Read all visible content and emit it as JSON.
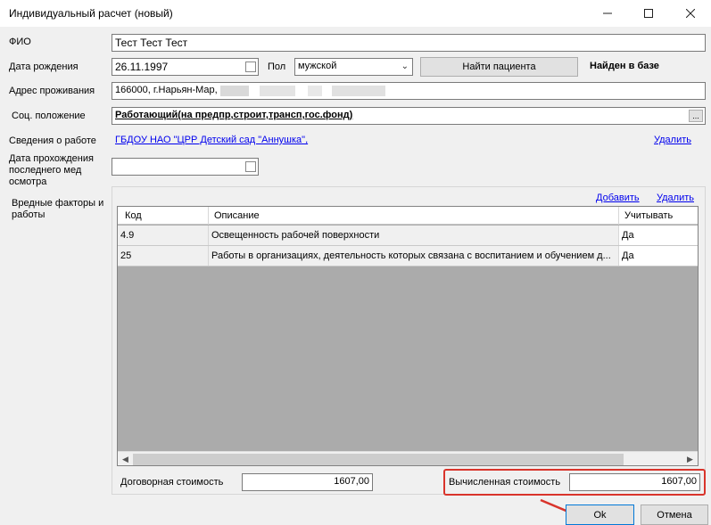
{
  "window": {
    "title": "Индивидуальный расчет (новый)"
  },
  "form": {
    "fio_label": "ФИО",
    "fio_value": "Тест Тест Тест",
    "dob_label": "Дата рождения",
    "dob_value": "26.11.1997",
    "sex_label": "Пол",
    "sex_value": "мужской",
    "find_button": "Найти пациента",
    "found_status": "Найден в базе",
    "address_label": "Адрес проживания",
    "address_value": "166000, г.Нарьян-Мар,",
    "social_label": "Соц. положение",
    "social_value": "Работающий(на предпр,строит,трансп,гос.фонд)",
    "ellipsis_button": "...",
    "work_label": "Сведения о работе",
    "work_value": "ГБДОУ НАО \"ЦРР  Детский сад \"Аннушка\",",
    "work_delete": "Удалить",
    "medexam_label": "Дата прохождения последнего мед осмотра",
    "medexam_value": "",
    "hazards_label": "Вредные факторы и работы",
    "hazards_add": "Добавить",
    "hazards_delete": "Удалить"
  },
  "table": {
    "columns": [
      "Код",
      "Описание",
      "Учитывать"
    ],
    "rows": [
      {
        "code": "4.9",
        "description": "Освещенность рабочей поверхности",
        "account": "Да"
      },
      {
        "code": "25",
        "description": "Работы в организациях, деятельность которых связана с воспитанием и обучением д...",
        "account": "Да"
      }
    ]
  },
  "costs": {
    "contract_label": "Договорная стоимость",
    "contract_value": "1607,00",
    "calculated_label": "Вычисленная стоимость",
    "calculated_value": "1607,00"
  },
  "buttons": {
    "ok": "Ok",
    "cancel": "Отмена"
  },
  "colors": {
    "highlight": "#d9342b",
    "link": "#0000ee",
    "grid_background": "#ababab"
  }
}
